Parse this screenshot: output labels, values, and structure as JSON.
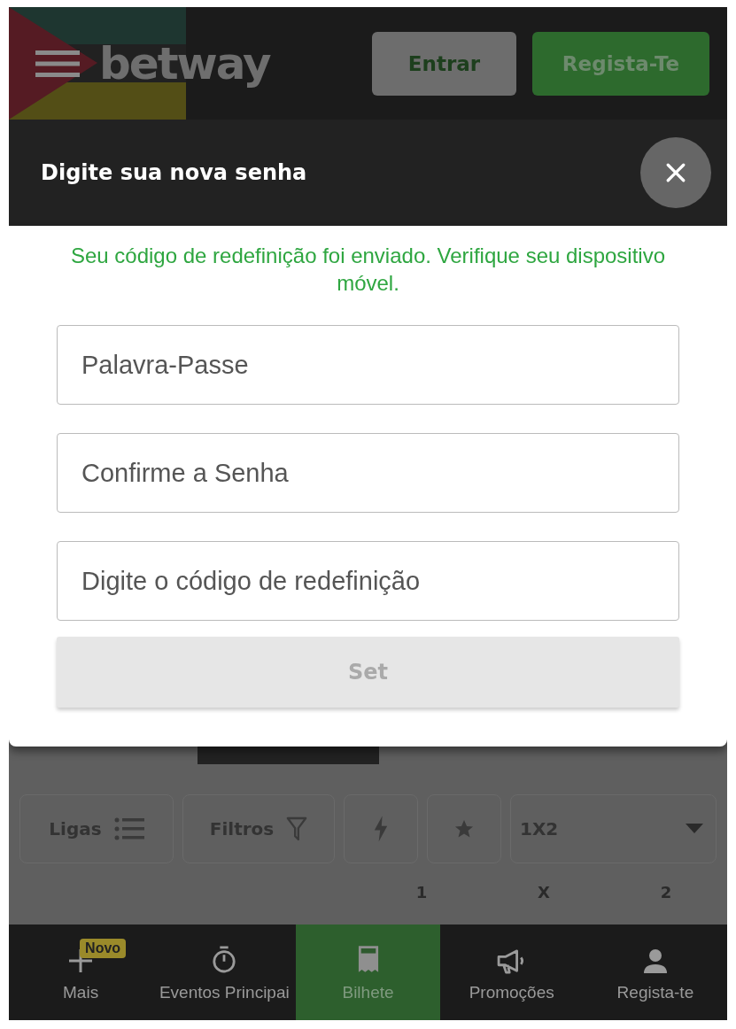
{
  "header": {
    "logo": "betway",
    "buttons": [
      {
        "label": "Entrar",
        "kind": "login"
      },
      {
        "label": "Regista-Te",
        "kind": "register"
      }
    ]
  },
  "modal": {
    "title": "Digite sua nova senha",
    "message": "Seu código de redefinição foi enviado. Verifique seu dispositivo móvel.",
    "fields": [
      {
        "placeholder": "Palavra-Passe"
      },
      {
        "placeholder": "Confirme a Senha"
      },
      {
        "placeholder": "Digite o código de redefinição"
      }
    ],
    "submit": {
      "label": "Set",
      "disabled": true
    }
  },
  "filters": [
    {
      "kind": "leagues",
      "label": "Ligas"
    },
    {
      "kind": "filter",
      "label": "Filtros"
    },
    {
      "kind": "live"
    },
    {
      "kind": "favorites"
    },
    {
      "kind": "market",
      "label": "1X2"
    }
  ],
  "odds_columns": [
    "1",
    "X",
    "2"
  ],
  "bottom_nav": [
    {
      "label": "Mais",
      "kind": "plus",
      "badge": "Novo",
      "selected": false
    },
    {
      "label": "Eventos Principai",
      "kind": "timer",
      "selected": false
    },
    {
      "label": "Bilhete",
      "kind": "ticket",
      "selected": true
    },
    {
      "label": "Promoções",
      "kind": "megaphone",
      "selected": false
    },
    {
      "label": "Regista-te",
      "kind": "user",
      "selected": false
    }
  ]
}
